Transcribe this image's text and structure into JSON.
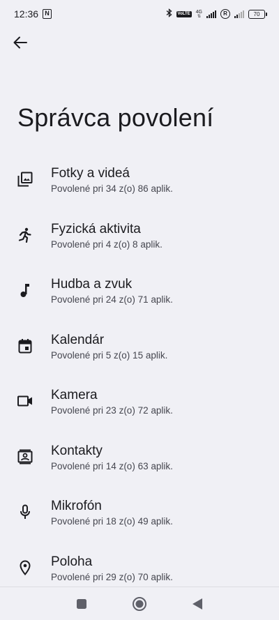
{
  "status_bar": {
    "time": "12:36",
    "battery": "70",
    "network": "4G",
    "volte": "VoLTE",
    "roaming": "R"
  },
  "header": {
    "title": "Správca povolení"
  },
  "permissions": [
    {
      "icon": "photo-icon",
      "title": "Fotky a videá",
      "subtitle": "Povolené pri 34 z(o) 86 aplik."
    },
    {
      "icon": "running-icon",
      "title": "Fyzická aktivita",
      "subtitle": "Povolené pri 4 z(o) 8 aplik."
    },
    {
      "icon": "music-note-icon",
      "title": "Hudba a zvuk",
      "subtitle": "Povolené pri 24 z(o) 71 aplik."
    },
    {
      "icon": "calendar-icon",
      "title": "Kalendár",
      "subtitle": "Povolené pri 5 z(o) 15 aplik."
    },
    {
      "icon": "camera-icon",
      "title": "Kamera",
      "subtitle": "Povolené pri 23 z(o) 72 aplik."
    },
    {
      "icon": "contacts-icon",
      "title": "Kontakty",
      "subtitle": "Povolené pri 14 z(o) 63 aplik."
    },
    {
      "icon": "microphone-icon",
      "title": "Mikrofón",
      "subtitle": "Povolené pri 18 z(o) 49 aplik."
    },
    {
      "icon": "location-icon",
      "title": "Poloha",
      "subtitle": "Povolené pri 29 z(o) 70 aplik."
    }
  ]
}
